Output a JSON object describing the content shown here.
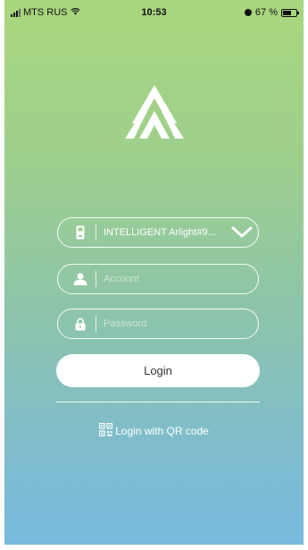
{
  "status_bar": {
    "carrier": "MTS RUS",
    "time": "10:53",
    "battery_text": "67 %",
    "battery_level": 0.67
  },
  "login_form": {
    "device_selector": {
      "value": "INTELLIGENT Arlight#9...",
      "icon": "device-icon"
    },
    "account": {
      "placeholder": "Account",
      "icon": "user-icon"
    },
    "password": {
      "placeholder": "Password",
      "icon": "lock-icon"
    },
    "login_button": "Login",
    "qr_login_label": "Login with QR code"
  },
  "colors": {
    "gradient_top": "#a9d67d",
    "gradient_bottom": "#78b9df",
    "foreground": "#ffffff"
  }
}
